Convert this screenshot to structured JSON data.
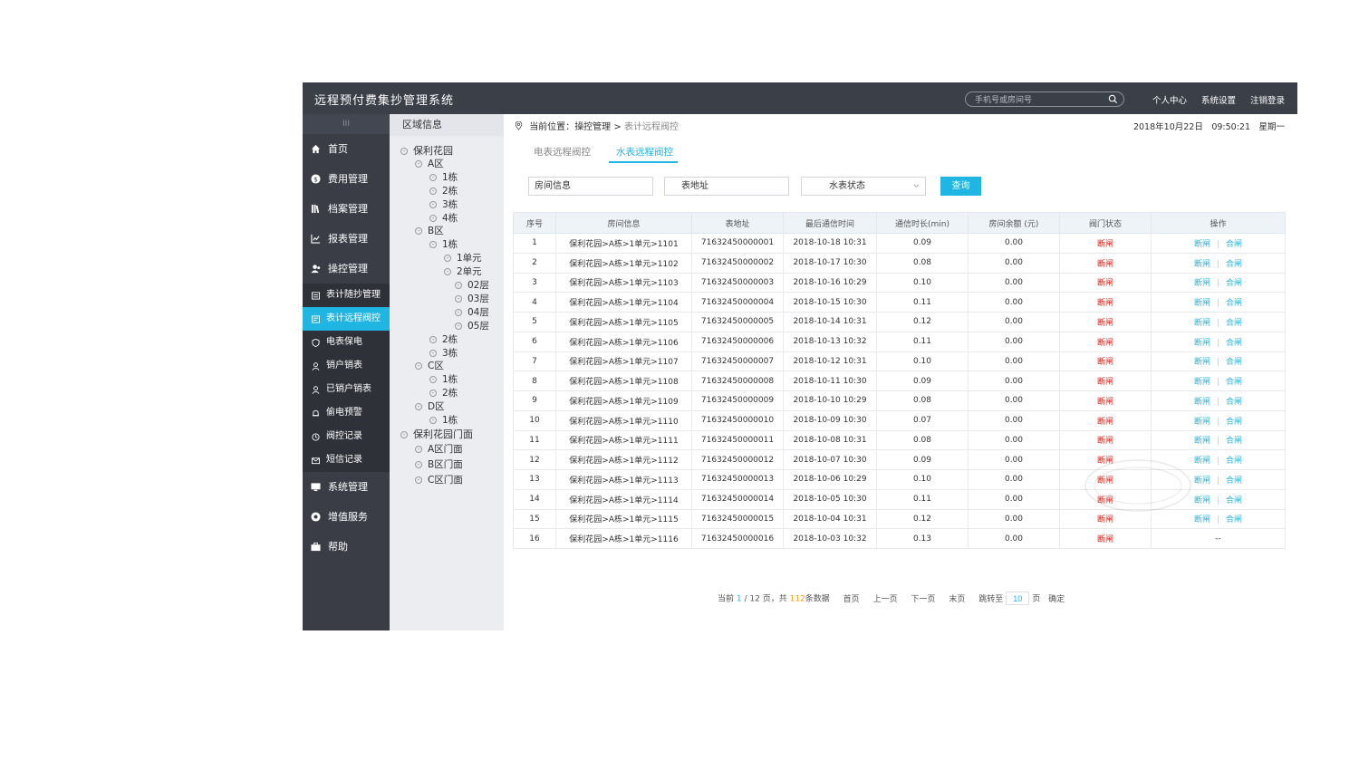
{
  "header": {
    "title": "远程预付费集抄管理系统",
    "search_placeholder": "手机号或房间号",
    "links": [
      "个人中心",
      "系统设置",
      "注销登录"
    ]
  },
  "sidebar": {
    "toggle": "III",
    "items": [
      {
        "label": "首页",
        "icon": "home-icon"
      },
      {
        "label": "费用管理",
        "icon": "dollar-icon"
      },
      {
        "label": "档案管理",
        "icon": "books-icon"
      },
      {
        "label": "报表管理",
        "icon": "chart-icon"
      },
      {
        "label": "操控管理",
        "icon": "users-icon"
      }
    ],
    "sub_items": [
      {
        "label": "表计随抄管理",
        "icon": "list-icon"
      },
      {
        "label": "表计远程阀控",
        "icon": "meter-icon",
        "active": true
      },
      {
        "label": "电表保电",
        "icon": "shield-icon"
      },
      {
        "label": "销户销表",
        "icon": "user-icon"
      },
      {
        "label": "已销户销表",
        "icon": "user-icon"
      },
      {
        "label": "偷电预警",
        "icon": "bell-icon"
      },
      {
        "label": "阀控记录",
        "icon": "clock-icon"
      },
      {
        "label": "短信记录",
        "icon": "mail-icon"
      }
    ],
    "bottom_items": [
      {
        "label": "系统管理",
        "icon": "monitor-icon"
      },
      {
        "label": "增值服务",
        "icon": "service-icon"
      },
      {
        "label": "帮助",
        "icon": "briefcase-icon"
      }
    ]
  },
  "tree": {
    "title": "区域信息",
    "nodes": [
      {
        "label": "保利花园",
        "level": 0
      },
      {
        "label": "A区",
        "level": 1
      },
      {
        "label": "1栋",
        "level": 2
      },
      {
        "label": "2栋",
        "level": 2
      },
      {
        "label": "3栋",
        "level": 2
      },
      {
        "label": "4栋",
        "level": 2
      },
      {
        "label": "B区",
        "level": 1
      },
      {
        "label": "1栋",
        "level": 2
      },
      {
        "label": "1单元",
        "level": 3
      },
      {
        "label": "2单元",
        "level": 3
      },
      {
        "label": "02层",
        "level": 4
      },
      {
        "label": "03层",
        "level": 4
      },
      {
        "label": "04层",
        "level": 4
      },
      {
        "label": "05层",
        "level": 4
      },
      {
        "label": "2栋",
        "level": 2
      },
      {
        "label": "3栋",
        "level": 2
      },
      {
        "label": "C区",
        "level": 1
      },
      {
        "label": "1栋",
        "level": 2
      },
      {
        "label": "2栋",
        "level": 2
      },
      {
        "label": "D区",
        "level": 1
      },
      {
        "label": "1栋",
        "level": 2
      },
      {
        "label": "保利花园门面",
        "level": 0
      },
      {
        "label": "A区门面",
        "level": 1
      },
      {
        "label": "B区门面",
        "level": 1
      },
      {
        "label": "C区门面",
        "level": 1
      }
    ]
  },
  "breadcrumb": {
    "prefix": "当前位置：",
    "parent": "操控管理",
    "arrow": ">",
    "current": "表计远程阀控"
  },
  "datetime": "2018年10月22日　09:50:21　星期一",
  "tabs": [
    "电表远程阀控",
    "水表远程阀控"
  ],
  "filters": {
    "room": "房间信息",
    "address": "表地址",
    "status": "水表状态",
    "query": "查询"
  },
  "table": {
    "columns": [
      "序号",
      "房间信息",
      "表地址",
      "最后通信时间",
      "通信时长(min)",
      "房间余额 (元)",
      "阀门状态",
      "操作"
    ],
    "action_off": "断闸",
    "action_on": "合闸",
    "rows": [
      [
        "1",
        "保利花园>A栋>1单元>1101",
        "71632450000001",
        "2018-10-18 10:31",
        "0.09",
        "0.00",
        "断闸"
      ],
      [
        "2",
        "保利花园>A栋>1单元>1102",
        "71632450000002",
        "2018-10-17 10:30",
        "0.08",
        "0.00",
        "断闸"
      ],
      [
        "3",
        "保利花园>A栋>1单元>1103",
        "71632450000003",
        "2018-10-16 10:29",
        "0.10",
        "0.00",
        "断闸"
      ],
      [
        "4",
        "保利花园>A栋>1单元>1104",
        "71632450000004",
        "2018-10-15 10:30",
        "0.11",
        "0.00",
        "断闸"
      ],
      [
        "5",
        "保利花园>A栋>1单元>1105",
        "71632450000005",
        "2018-10-14 10:31",
        "0.12",
        "0.00",
        "断闸"
      ],
      [
        "6",
        "保利花园>A栋>1单元>1106",
        "71632450000006",
        "2018-10-13 10:32",
        "0.11",
        "0.00",
        "断闸"
      ],
      [
        "7",
        "保利花园>A栋>1单元>1107",
        "71632450000007",
        "2018-10-12 10:31",
        "0.10",
        "0.00",
        "断闸"
      ],
      [
        "8",
        "保利花园>A栋>1单元>1108",
        "71632450000008",
        "2018-10-11 10:30",
        "0.09",
        "0.00",
        "断闸"
      ],
      [
        "9",
        "保利花园>A栋>1单元>1109",
        "71632450000009",
        "2018-10-10 10:29",
        "0.08",
        "0.00",
        "断闸"
      ],
      [
        "10",
        "保利花园>A栋>1单元>1110",
        "71632450000010",
        "2018-10-09 10:30",
        "0.07",
        "0.00",
        "断闸"
      ],
      [
        "11",
        "保利花园>A栋>1单元>1111",
        "71632450000011",
        "2018-10-08 10:31",
        "0.08",
        "0.00",
        "断闸"
      ],
      [
        "12",
        "保利花园>A栋>1单元>1112",
        "71632450000012",
        "2018-10-07 10:30",
        "0.09",
        "0.00",
        "断闸"
      ],
      [
        "13",
        "保利花园>A栋>1单元>1113",
        "71632450000013",
        "2018-10-06 10:29",
        "0.10",
        "0.00",
        "断闸"
      ],
      [
        "14",
        "保利花园>A栋>1单元>1114",
        "71632450000014",
        "2018-10-05 10:30",
        "0.11",
        "0.00",
        "断闸"
      ],
      [
        "15",
        "保利花园>A栋>1单元>1115",
        "71632450000015",
        "2018-10-04 10:31",
        "0.12",
        "0.00",
        "断闸"
      ],
      [
        "16",
        "保利花园>A栋>1单元>1116",
        "71632450000016",
        "2018-10-03 10:32",
        "0.13",
        "0.00",
        "断闸"
      ]
    ],
    "last_row_action": "--"
  },
  "pager": {
    "t1": "当前",
    "current": "1",
    "t2": "/ 12 页，共",
    "total": "112",
    "t3": "条数据",
    "first": "首页",
    "prev": "上一页",
    "next": "下一页",
    "last": "末页",
    "jump_label": "跳转至",
    "jump_value": "10",
    "page_unit": "页",
    "confirm": "确定"
  },
  "colors": {
    "accent": "#1fb6e3",
    "sidebar": "#3a3d46",
    "header": "#3b3f48",
    "danger": "#e0231a",
    "highlight": "#f39c12"
  }
}
